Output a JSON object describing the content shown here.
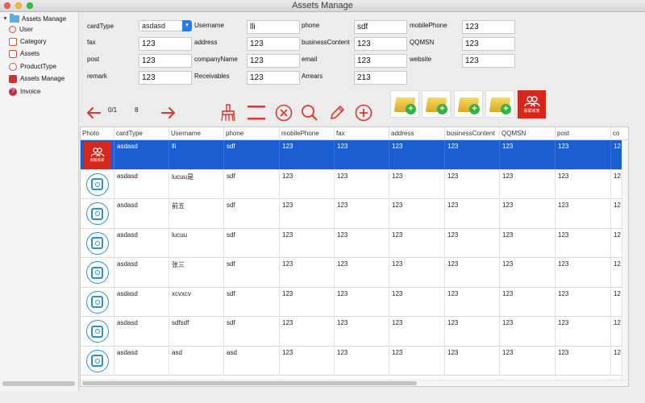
{
  "window": {
    "title": "Assets Manage"
  },
  "sidebar": {
    "root": "Assets Manage",
    "items": [
      {
        "label": "User",
        "icon": "user-icon",
        "color": "#e0463a"
      },
      {
        "label": "Category",
        "icon": "category-icon",
        "color": "#e05b2b"
      },
      {
        "label": "Assets",
        "icon": "assets-icon",
        "color": "#e14a3b"
      },
      {
        "label": "ProductType",
        "icon": "product-type-icon",
        "color": "#d9483c"
      },
      {
        "label": "Assets Manage",
        "icon": "puzzle-icon",
        "color": "#d52f2f"
      },
      {
        "label": "Invoice",
        "icon": "help-circle-icon",
        "color": "#c32a4d"
      }
    ]
  },
  "form": {
    "cardType": {
      "label": "cardType",
      "value": "asdasd"
    },
    "username": {
      "label": "Username",
      "value": "lli"
    },
    "phone": {
      "label": "phone",
      "value": "sdf"
    },
    "mobilePhone": {
      "label": "mobilePhone",
      "value": "123"
    },
    "fax": {
      "label": "fax",
      "value": "123"
    },
    "address": {
      "label": "address",
      "value": "123"
    },
    "businessContent": {
      "label": "businessContent",
      "value": "123"
    },
    "qqmsn": {
      "label": "QQMSN",
      "value": "123"
    },
    "post": {
      "label": "post",
      "value": "123"
    },
    "companyName": {
      "label": "companyName",
      "value": "123"
    },
    "email": {
      "label": "email",
      "value": "123"
    },
    "website": {
      "label": "website",
      "value": "123"
    },
    "remark": {
      "label": "remark",
      "value": "123"
    },
    "receivables": {
      "label": "Receivables",
      "value": "123"
    },
    "arrears": {
      "label": "Arrears",
      "value": "213"
    }
  },
  "toolbar": {
    "page_current": "0/1",
    "page_total": "8",
    "brand_caption": "易联商家",
    "accent_color": "#d7261b"
  },
  "table": {
    "columns": [
      "Photo",
      "cardType",
      "Username",
      "phone",
      "mobilePhone",
      "fax",
      "address",
      "businessContent",
      "QQMSN",
      "post",
      "co"
    ],
    "rows": [
      {
        "cardType": "asdasd",
        "username": "lli",
        "phone": "sdf",
        "mobilePhone": "123",
        "fax": "123",
        "address": "123",
        "businessContent": "123",
        "qqmsn": "123",
        "post": "123",
        "extra": "12"
      },
      {
        "cardType": "asdasd",
        "username": "lucuu是",
        "phone": "sdf",
        "mobilePhone": "123",
        "fax": "123",
        "address": "123",
        "businessContent": "123",
        "qqmsn": "123",
        "post": "123",
        "extra": "12"
      },
      {
        "cardType": "asdasd",
        "username": "前五",
        "phone": "sdf",
        "mobilePhone": "123",
        "fax": "123",
        "address": "123",
        "businessContent": "123",
        "qqmsn": "123",
        "post": "123",
        "extra": "12"
      },
      {
        "cardType": "asdasd",
        "username": "lucuu",
        "phone": "sdf",
        "mobilePhone": "123",
        "fax": "123",
        "address": "123",
        "businessContent": "123",
        "qqmsn": "123",
        "post": "123",
        "extra": "12"
      },
      {
        "cardType": "asdasd",
        "username": "张三",
        "phone": "sdf",
        "mobilePhone": "123",
        "fax": "123",
        "address": "123",
        "businessContent": "123",
        "qqmsn": "123",
        "post": "123",
        "extra": "12"
      },
      {
        "cardType": "asdasd",
        "username": "xcvxcv",
        "phone": "sdf",
        "mobilePhone": "123",
        "fax": "123",
        "address": "123",
        "businessContent": "123",
        "qqmsn": "123",
        "post": "123",
        "extra": "12"
      },
      {
        "cardType": "asdasd",
        "username": "sdfsdf",
        "phone": "sdf",
        "mobilePhone": "123",
        "fax": "123",
        "address": "123",
        "businessContent": "123",
        "qqmsn": "123",
        "post": "123",
        "extra": "12"
      },
      {
        "cardType": "asdasd",
        "username": "asd",
        "phone": "asd",
        "mobilePhone": "123",
        "fax": "123",
        "address": "123",
        "businessContent": "123",
        "qqmsn": "123",
        "post": "123",
        "extra": "12"
      }
    ]
  }
}
